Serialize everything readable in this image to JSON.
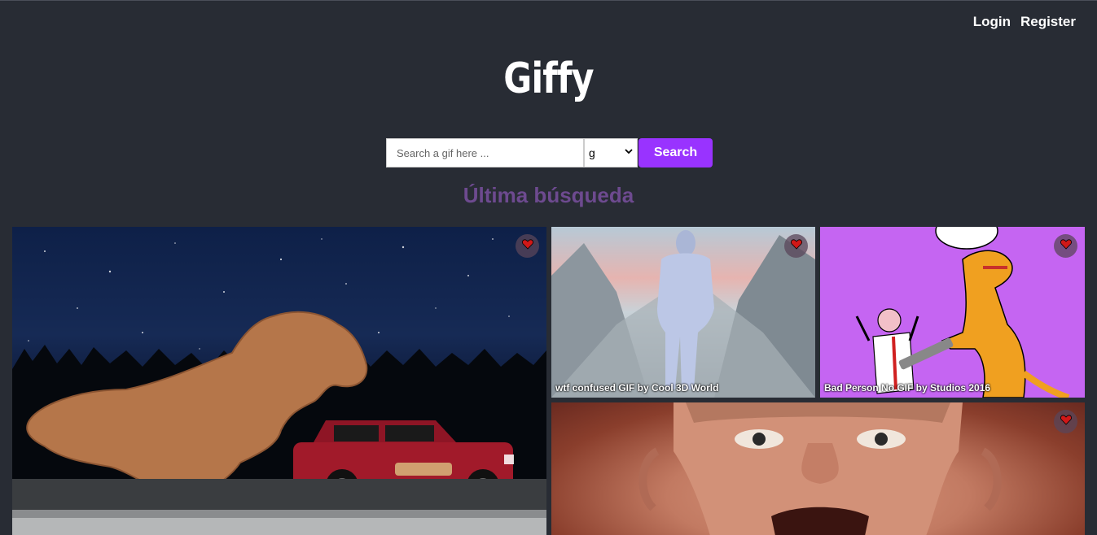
{
  "nav": {
    "login_label": "Login",
    "register_label": "Register"
  },
  "logo": {
    "text": "Giffy"
  },
  "search": {
    "placeholder": "Search a gif here ...",
    "value": "",
    "rating_selected": "g",
    "button_label": "Search"
  },
  "section": {
    "title": "Última búsqueda"
  },
  "gifs": [
    {
      "title": "",
      "fav_icon": "heart-icon"
    },
    {
      "title": "wtf confused GIF by Cool 3D World",
      "fav_icon": "heart-icon"
    },
    {
      "title": "Bad Person No GIF by Studios 2016",
      "fav_icon": "heart-icon"
    },
    {
      "title": "",
      "fav_icon": "heart-icon"
    }
  ],
  "colors": {
    "background": "#282c34",
    "accent": "#9933ff",
    "section_title": "#6d4a8f"
  }
}
